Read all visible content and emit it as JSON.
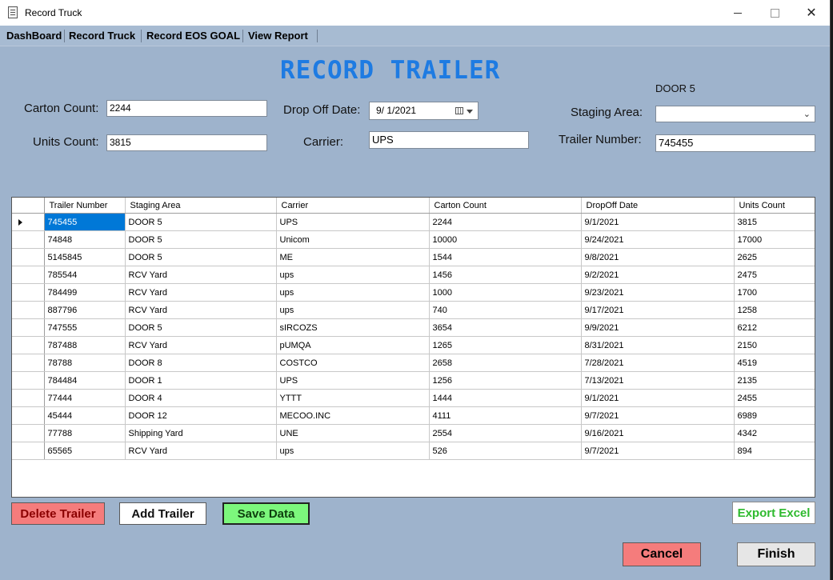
{
  "window": {
    "title": "Record Truck",
    "minimize_glyph": "",
    "close_glyph": "✕"
  },
  "menu": [
    "DashBoard",
    "Record Truck",
    "Record EOS GOAL",
    "View Report"
  ],
  "page_title": "RECORD TRAILER",
  "form": {
    "carton_count_label": "Carton Count:",
    "carton_count_value": "2244",
    "units_count_label": "Units Count:",
    "units_count_value": "3815",
    "drop_off_date_label": "Drop Off Date:",
    "drop_off_date_value": "9/  1/2021",
    "carrier_label": "Carrier:",
    "carrier_value": "UPS",
    "staging_area_label": "Staging Area:",
    "staging_area_value": "",
    "door_display": "DOOR 5",
    "trailer_number_label": "Trailer Number:",
    "trailer_number_value": "745455"
  },
  "table": {
    "columns": [
      "Trailer Number",
      "Staging Area",
      "Carrier",
      "Carton Count",
      "DropOff Date",
      "Units Count"
    ],
    "rows": [
      [
        "745455",
        "DOOR 5",
        "UPS",
        "2244",
        "9/1/2021",
        "3815"
      ],
      [
        "74848",
        "DOOR 5",
        "Unicom",
        "10000",
        "9/24/2021",
        "17000"
      ],
      [
        "5145845",
        "DOOR 5",
        "ME",
        "1544",
        "9/8/2021",
        "2625"
      ],
      [
        "785544",
        "RCV Yard",
        "ups",
        "1456",
        "9/2/2021",
        "2475"
      ],
      [
        "784499",
        "RCV Yard",
        "ups",
        "1000",
        "9/23/2021",
        "1700"
      ],
      [
        "887796",
        "RCV Yard",
        "ups",
        "740",
        "9/17/2021",
        "1258"
      ],
      [
        "747555",
        "DOOR 5",
        "sIRCOZS",
        "3654",
        "9/9/2021",
        "6212"
      ],
      [
        "787488",
        "RCV Yard",
        "pUMQA",
        "1265",
        "8/31/2021",
        "2150"
      ],
      [
        "78788",
        "DOOR 8",
        "COSTCO",
        "2658",
        "7/28/2021",
        "4519"
      ],
      [
        "784484",
        "DOOR 1",
        "UPS",
        "1256",
        "7/13/2021",
        "2135"
      ],
      [
        "77444",
        "DOOR 4",
        "YTTT",
        "1444",
        "9/1/2021",
        "2455"
      ],
      [
        "45444",
        "DOOR 12",
        "MECOO.INC",
        "4111",
        "9/7/2021",
        "6989"
      ],
      [
        "77788",
        "Shipping Yard",
        "UNE",
        "2554",
        "9/16/2021",
        "4342"
      ],
      [
        "65565",
        "RCV Yard",
        "ups",
        "526",
        "9/7/2021",
        "894"
      ]
    ],
    "selected_row": 0
  },
  "buttons": {
    "delete": "Delete Trailer",
    "add": "Add Trailer",
    "save": "Save Data",
    "export": "Export Excel",
    "cancel": "Cancel",
    "finish": "Finish"
  },
  "colors": {
    "background": "#9eb3cc",
    "title": "#1e7be2",
    "delete": "#f57c7c",
    "save": "#7cf77c",
    "export_text": "#2fba2f",
    "selection": "#0078d7"
  },
  "icons": [
    "app-icon",
    "calendar-icon",
    "dropdown-chevron-icon",
    "row-selector-icon"
  ]
}
